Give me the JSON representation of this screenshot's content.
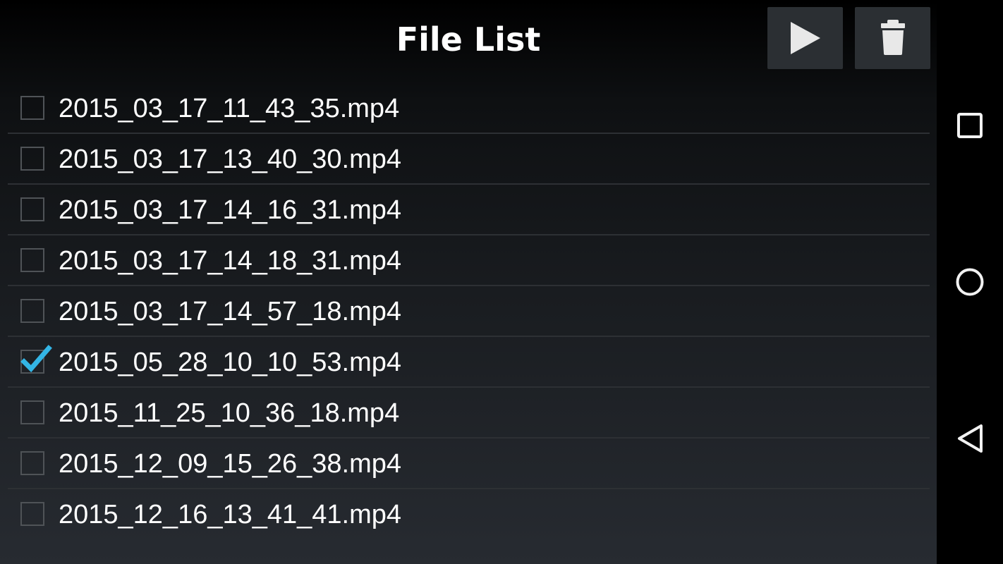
{
  "header": {
    "title": "File List",
    "play_icon": "play-icon",
    "delete_icon": "trash-icon"
  },
  "files": [
    {
      "name": "2015_03_17_11_43_35.mp4",
      "checked": false
    },
    {
      "name": "2015_03_17_13_40_30.mp4",
      "checked": false
    },
    {
      "name": "2015_03_17_14_16_31.mp4",
      "checked": false
    },
    {
      "name": "2015_03_17_14_18_31.mp4",
      "checked": false
    },
    {
      "name": "2015_03_17_14_57_18.mp4",
      "checked": false
    },
    {
      "name": "2015_05_28_10_10_53.mp4",
      "checked": true
    },
    {
      "name": "2015_11_25_10_36_18.mp4",
      "checked": false
    },
    {
      "name": "2015_12_09_15_26_38.mp4",
      "checked": false
    },
    {
      "name": "2015_12_16_13_41_41.mp4",
      "checked": false
    }
  ],
  "nav_bar": {
    "recents_icon": "square-icon",
    "home_icon": "circle-icon",
    "back_icon": "triangle-back-icon"
  },
  "colors": {
    "checkmark": "#33b5e5",
    "button_bg": "#2b2f33",
    "text": "#ffffff"
  }
}
